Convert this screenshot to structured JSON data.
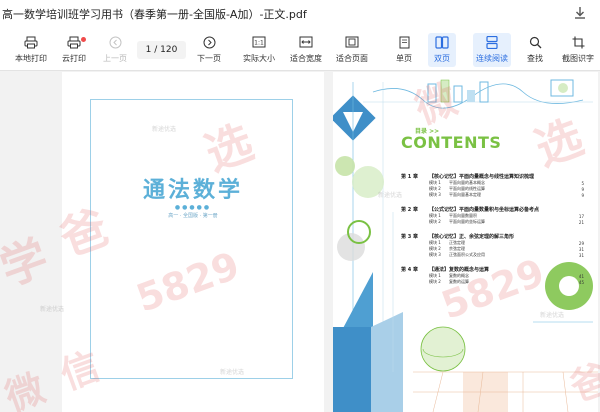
{
  "window": {
    "title": "高一数学培训班学习用书（春季第一册-全国版-A加）-正文.pdf"
  },
  "toolbar": {
    "local_print": "本地打印",
    "cloud_print": "云打印",
    "prev_page": "上一页",
    "page_indicator": "1  / 120",
    "next_page": "下一页",
    "actual_size": "实际大小",
    "fit_width": "适合宽度",
    "fit_page": "适合页面",
    "single_page": "单页",
    "double_page": "双页",
    "continuous": "连续阅读",
    "search": "查找",
    "screenshot_ocr": "截图识字",
    "accent": "#2c6ee0"
  },
  "left_page": {
    "cover_title": "通法数学",
    "cover_dots": "●●●●●",
    "cover_sub": "高一 · 全国版 · 第一册"
  },
  "watermark": {
    "chars": [
      "学",
      "爸",
      "选",
      "微",
      "信"
    ],
    "number": "5829",
    "small": "新途优选"
  },
  "right_page": {
    "toc_small": "目录 >>",
    "toc_title": "CONTENTS",
    "chapters": [
      {
        "num": "第 1 章",
        "title": "【核心记忆】平面向量概念与线性运算知识梳理",
        "modules": [
          {
            "m": "模块 1",
            "t": "平面向量的基本概念",
            "p": "5"
          },
          {
            "m": "模块 2",
            "t": "平面向量的线性运算",
            "p": "9"
          },
          {
            "m": "模块 3",
            "t": "平面向量基本定理",
            "p": "9"
          }
        ]
      },
      {
        "num": "第 2 章",
        "title": "【公式记忆】平面向量数量积与坐标运算必备考点",
        "modules": [
          {
            "m": "模块 1",
            "t": "平面向量数量积",
            "p": "17"
          },
          {
            "m": "模块 2",
            "t": "平面向量的坐标运算",
            "p": "21"
          }
        ]
      },
      {
        "num": "第 3 章",
        "title": "【核心记忆】正、余弦定理的解三角形",
        "modules": [
          {
            "m": "模块 1",
            "t": "正弦定理",
            "p": "29"
          },
          {
            "m": "模块 2",
            "t": "余弦定理",
            "p": "31"
          },
          {
            "m": "模块 3",
            "t": "正弦面积公式及应用",
            "p": "31"
          }
        ]
      },
      {
        "num": "第 4 章",
        "title": "【通法】复数的概念与运算",
        "modules": [
          {
            "m": "模块 1",
            "t": "复数的概念",
            "p": "41"
          },
          {
            "m": "模块 2",
            "t": "复数的运算",
            "p": "45"
          }
        ]
      }
    ]
  }
}
